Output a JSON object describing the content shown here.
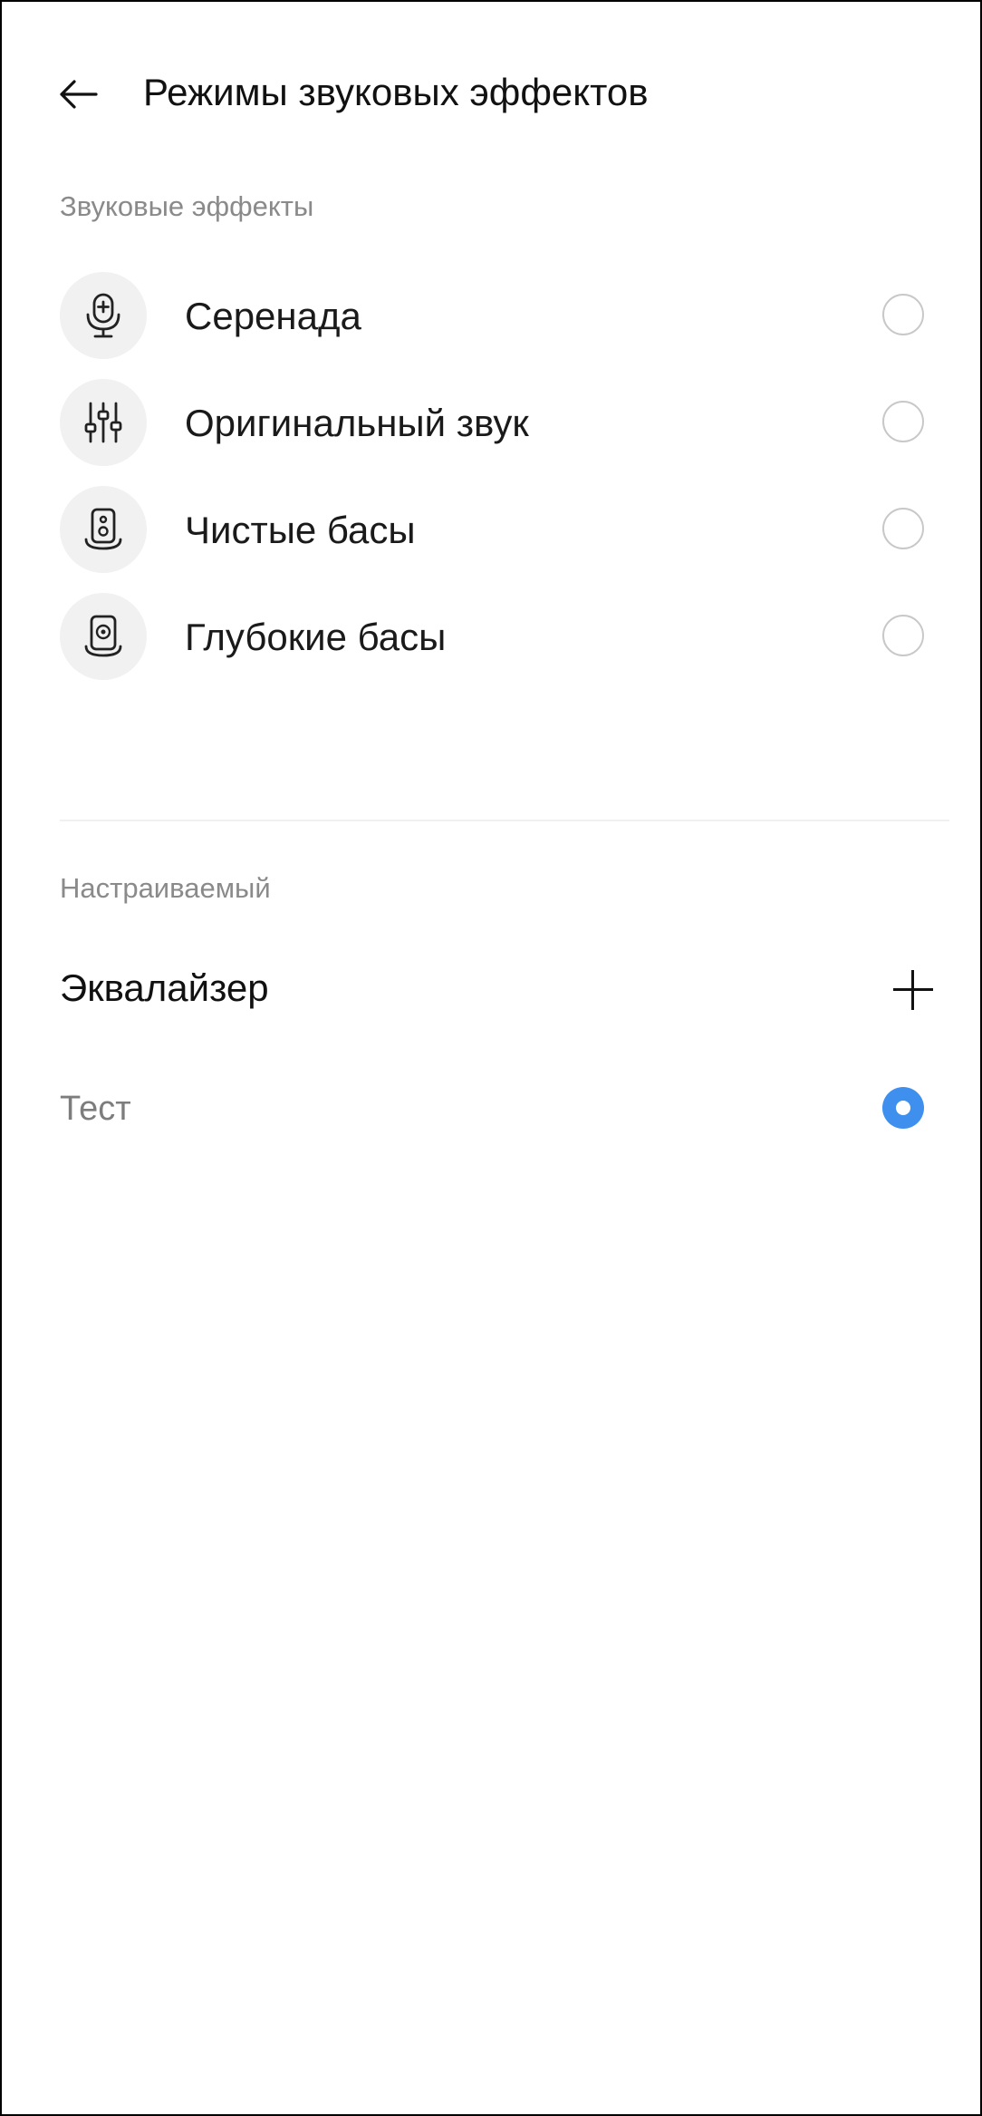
{
  "header": {
    "title": "Режимы звуковых эффектов",
    "back_icon": "arrow-left-icon"
  },
  "sound_effects": {
    "section_title": "Звуковые эффекты",
    "items": [
      {
        "label": "Серенада",
        "icon": "microphone-icon",
        "selected": false
      },
      {
        "label": "Оригинальный звук",
        "icon": "equalizer-sliders-icon",
        "selected": false
      },
      {
        "label": "Чистые басы",
        "icon": "speaker-icon",
        "selected": false
      },
      {
        "label": "Глубокие басы",
        "icon": "speaker-deep-icon",
        "selected": false
      }
    ]
  },
  "custom": {
    "section_title": "Настраиваемый",
    "equalizer_label": "Эквалайзер",
    "add_icon": "plus-icon",
    "presets": [
      {
        "label": "Тест",
        "selected": true
      }
    ]
  },
  "colors": {
    "accent": "#3f90ee",
    "secondary_text": "#8a8a8a",
    "icon_background": "#f1f1f1"
  }
}
